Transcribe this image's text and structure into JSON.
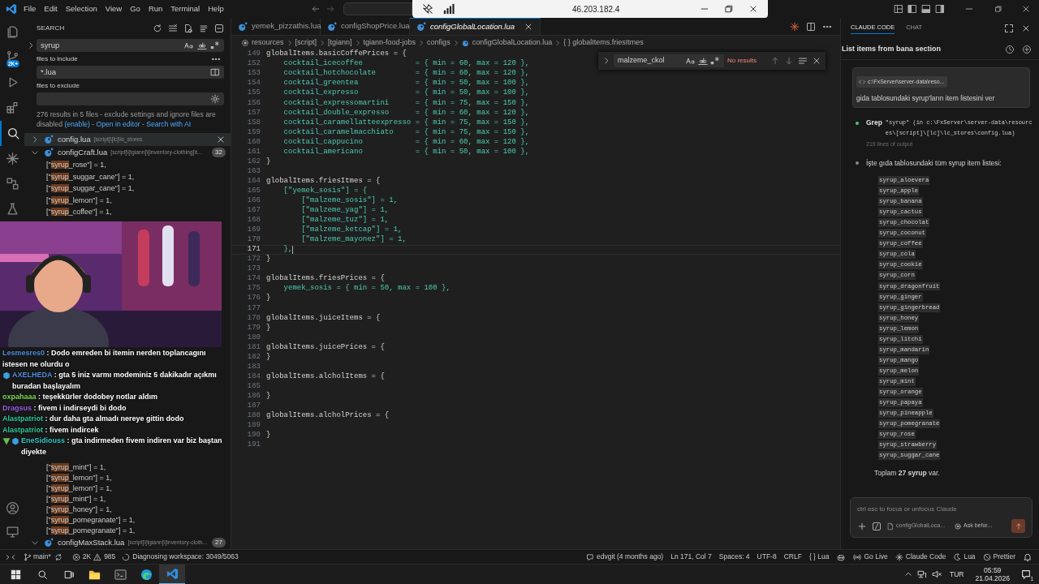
{
  "title_bar": {
    "menu": [
      "File",
      "Edit",
      "Selection",
      "View",
      "Go",
      "Run",
      "Terminal",
      "Help"
    ],
    "remote_address": "46.203.182.4"
  },
  "activity_bar": {
    "source_control_badge": "2K+"
  },
  "search": {
    "title": "SEARCH",
    "query": "syrup",
    "include_label": "files to include",
    "include": "*.lua",
    "exclude_label": "files to exclude",
    "message": [
      {
        "kind": "text",
        "text": "276 results in 5 files - exclude settings and ignore files are disabled "
      },
      {
        "kind": "link",
        "text": "(enable)"
      },
      {
        "kind": "text",
        "text": " - "
      },
      {
        "kind": "link",
        "text": "Open in editor"
      },
      {
        "kind": "text",
        "text": " - "
      },
      {
        "kind": "link",
        "text": "Search with AI"
      }
    ],
    "results": [
      {
        "file": "config.lua",
        "path": "[script]\\[lc]\\lc_stores",
        "expanded": false,
        "selected": true
      },
      {
        "file": "configCraft.lua",
        "path": "[script]\\[tgiann]\\[inventory-clothing]\\t...",
        "count": "32",
        "expanded": true,
        "selected": false,
        "matches": [
          {
            "before": "[\"",
            "match": "syrup",
            "after": "_rose\"] = 1,"
          },
          {
            "before": "[\"",
            "match": "syrup",
            "after": "_suggar_cane\"] = 1,"
          },
          {
            "before": "[\"",
            "match": "syrup",
            "after": "_suggar_cane\"] = 1,"
          },
          {
            "before": "[\"",
            "match": "syrup",
            "after": "_lemon\"] = 1,"
          },
          {
            "before": "[\"",
            "match": "syrup",
            "after": "_coffee\"] = 1,"
          }
        ]
      }
    ],
    "results_below_stream": {
      "matches": [
        {
          "before": "[\"",
          "match": "syrup",
          "after": "_mint\"] = 1,"
        },
        {
          "before": "[\"",
          "match": "syrup",
          "after": "_lemon\"] = 1,"
        },
        {
          "before": "[\"",
          "match": "syrup",
          "after": "_lemon\"] = 1,"
        },
        {
          "before": "[\"",
          "match": "syrup",
          "after": "_mint\"] = 1,"
        },
        {
          "before": "[\"",
          "match": "syrup",
          "after": "_honey\"] = 1,"
        },
        {
          "before": "[\"",
          "match": "syrup",
          "after": "_pomegranate\"] = 1,"
        },
        {
          "before": "[\"",
          "match": "syrup",
          "after": "_pomegranate\"] = 1,"
        }
      ],
      "files": [
        {
          "file": "configMaxStack.lua",
          "path": "[script]\\[tgiann]\\[inventory-cloth...",
          "count": "27",
          "expanded": true,
          "selected": false
        }
      ]
    }
  },
  "stream": {
    "kind": "picture",
    "chat": [
      {
        "user": "Lesmesres0",
        "color": "#4f8fe0",
        "kind": "plain",
        "text": ": Dodo emreden bi itemin nerden toplancagını istesen ne olurdu o"
      },
      {
        "user": "AXELHEDA",
        "color": "#4f8fe0",
        "kind": "cube",
        "text": ": gta 5 iniz varmı modeminiz 5 dakikadır açıkmı buradan başlayalım"
      },
      {
        "user": "oxpahaaa",
        "color": "#7ed957",
        "kind": "plain",
        "text": ": teşekkürler dodobey notlar aldım"
      },
      {
        "user": "Dragsus",
        "color": "#9b5de5",
        "kind": "plain",
        "text": ": fivem i indirseydi bi dodo"
      },
      {
        "user": "Alastpatriot",
        "color": "#2ec99a",
        "kind": "plain",
        "text": ": dur daha gta almadı nereye gittin dodo"
      },
      {
        "user": "Alastpatriot",
        "color": "#2ec99a",
        "kind": "plain",
        "text": ": fivem indircek"
      },
      {
        "user": "EneSidiouss",
        "color": "#33c6c6",
        "kind": "chevron_cube",
        "text": ": gta indirmeden fivem indiren var biz baştan diyekte"
      }
    ]
  },
  "editor": {
    "tabs": [
      {
        "label": "yemek_pizzathis.lua",
        "selected": false
      },
      {
        "label": "configShopPrice.lua",
        "selected": false
      },
      {
        "label": "configGlobalLocation.lua",
        "selected": true
      }
    ],
    "breadcrumb": [
      "resources",
      "[script]",
      "[tgiann]",
      "tgiann-food-jobs",
      "configs",
      "configGlobalLocation.lua",
      "{ } globalItems.friesItmes"
    ],
    "find": {
      "query": "malzeme_ckol",
      "status": "No results"
    },
    "lines": [
      {
        "n": "149",
        "text": "globalItems.basicCoffePrices = {",
        "current": false
      },
      {
        "n": "152",
        "text": "    cocktail_icecoffee            = { min = 60, max = 120 },",
        "current": false
      },
      {
        "n": "153",
        "text": "    cocktail_hotchocolate         = { min = 60, max = 120 },",
        "current": false
      },
      {
        "n": "154",
        "text": "    cocktail_greentea             = { min = 50, max = 100 },",
        "current": false
      },
      {
        "n": "155",
        "text": "    cocktail_expresso             = { min = 50, max = 100 },",
        "current": false
      },
      {
        "n": "156",
        "text": "    cocktail_expressomartini      = { min = 75, max = 150 },",
        "current": false
      },
      {
        "n": "157",
        "text": "    cocktail_double_expresso      = { min = 60, max = 120 },",
        "current": false
      },
      {
        "n": "158",
        "text": "    cocktail_caramellatteexpresso = { min = 75, max = 150 },",
        "current": false
      },
      {
        "n": "159",
        "text": "    cocktail_caramelmacchiato     = { min = 75, max = 150 },",
        "current": false
      },
      {
        "n": "160",
        "text": "    cocktail_cappucino            = { min = 60, max = 120 },",
        "current": false
      },
      {
        "n": "161",
        "text": "    cocktail_americano            = { min = 50, max = 100 },",
        "current": false
      },
      {
        "n": "162",
        "text": "}",
        "current": false
      },
      {
        "n": "163",
        "current": false
      },
      {
        "n": "164",
        "text": "globalItems.friesItmes = {",
        "current": false
      },
      {
        "n": "165",
        "text": "    [\"yemek_sosis\"] = {",
        "current": false
      },
      {
        "n": "166",
        "text": "        [\"malzeme_sosis\"] = 1,",
        "current": false
      },
      {
        "n": "167",
        "text": "        [\"malzeme_yag\"] = 1,",
        "current": false
      },
      {
        "n": "168",
        "text": "        [\"malzeme_tuz\"] = 1,",
        "current": false
      },
      {
        "n": "169",
        "text": "        [\"malzeme_ketcap\"] = 1,",
        "current": false
      },
      {
        "n": "170",
        "text": "        [\"malzeme_mayonez\"] = 1,",
        "current": false
      },
      {
        "n": "171",
        "text": "    },",
        "current": true
      },
      {
        "n": "172",
        "text": "}",
        "current": false
      },
      {
        "n": "173",
        "current": false
      },
      {
        "n": "174",
        "text": "globalItems.friesPrices = {",
        "current": false
      },
      {
        "n": "175",
        "text": "    yemek_sosis = { min = 50, max = 100 },",
        "current": false
      },
      {
        "n": "176",
        "text": "}",
        "current": false
      },
      {
        "n": "177",
        "current": false
      },
      {
        "n": "178",
        "text": "globalItems.juiceItems = {",
        "current": false
      },
      {
        "n": "179",
        "text": "}",
        "current": false
      },
      {
        "n": "180",
        "current": false
      },
      {
        "n": "181",
        "text": "globalItems.juicePrices = {",
        "current": false
      },
      {
        "n": "182",
        "text": "}",
        "current": false
      },
      {
        "n": "183",
        "current": false
      },
      {
        "n": "184",
        "text": "globalItems.alcholItems = {",
        "current": false
      },
      {
        "n": "185",
        "current": false
      },
      {
        "n": "186",
        "text": "}",
        "current": false
      },
      {
        "n": "187",
        "current": false
      },
      {
        "n": "188",
        "text": "globalItems.alcholPrices = {",
        "current": false
      },
      {
        "n": "189",
        "current": false
      },
      {
        "n": "190",
        "text": "}",
        "current": false
      },
      {
        "n": "191",
        "current": false
      }
    ]
  },
  "claude": {
    "tabs": [
      {
        "label": "CLAUDE CODE",
        "selected": true
      },
      {
        "label": "CHAT",
        "selected": false
      }
    ],
    "title": "List items from bana section",
    "user_message": {
      "file": "c:\\FxServer\\server-data\\reso...",
      "text": "gida tablosundaki syrup'ların item listesini ver"
    },
    "tool": {
      "name": "Grep",
      "detail": "\"syrup\" (in c:\\FxServer\\server-data\\resources\\[script]\\[lc]\\lc_stores\\config.lua)",
      "output": "219 lines of output"
    },
    "reply": {
      "intro": "İşte gıda tablosundaki tüm syrup item listesi:",
      "items": [
        "syrup_aloevera",
        "syrup_apple",
        "syrup_banana",
        "syrup_cactus",
        "syrup_chocolat",
        "syrup_coconut",
        "syrup_coffee",
        "syrup_cola",
        "syrup_cookie",
        "syrup_corn",
        "syrup_dragonfruit",
        "syrup_ginger",
        "syrup_gingerbread",
        "syrup_honey",
        "syrup_lemon",
        "syrup_litchi",
        "syrup_mandarin",
        "syrup_mango",
        "syrup_melon",
        "syrup_mint",
        "syrup_orange",
        "syrup_papaya",
        "syrup_pineapple",
        "syrup_pomegranate",
        "syrup_rose",
        "syrup_strawberry",
        "syrup_suggar_cane"
      ],
      "summary": "Toplam **27 syrup** var."
    },
    "input": {
      "placeholder": "ctrl esc to focus or unfocus Claude",
      "file_chip": "configGlobalLoca…",
      "mode": "Ask befor..."
    }
  },
  "status_bar": {
    "branch": "main*",
    "errors": "2K",
    "warnings": "985",
    "task": "Diagnosing workspace: 3049/5063",
    "right": [
      {
        "kind": "git",
        "text": "edvgit (4 months ago)"
      },
      {
        "kind": "text",
        "text": "Ln 171, Col 7"
      },
      {
        "kind": "text",
        "text": "Spaces: 4"
      },
      {
        "kind": "text",
        "text": "UTF-8"
      },
      {
        "kind": "text",
        "text": "CRLF"
      },
      {
        "kind": "text",
        "text": "{ } Lua"
      },
      {
        "kind": "golive",
        "text": "Go Live"
      },
      {
        "kind": "claude",
        "text": "Claude Code"
      },
      {
        "kind": "moon",
        "text": "Lua"
      },
      {
        "kind": "prettier",
        "text": "Prettier"
      }
    ]
  },
  "taskbar": {
    "apps": [
      {
        "kind": "explorer",
        "selected": false
      },
      {
        "kind": "terminal",
        "selected": false
      },
      {
        "kind": "edge",
        "selected": false
      },
      {
        "kind": "vscode",
        "selected": true
      }
    ],
    "language": "TUR",
    "time": "05:59",
    "date": "21.04.2026",
    "notifications": "1"
  }
}
